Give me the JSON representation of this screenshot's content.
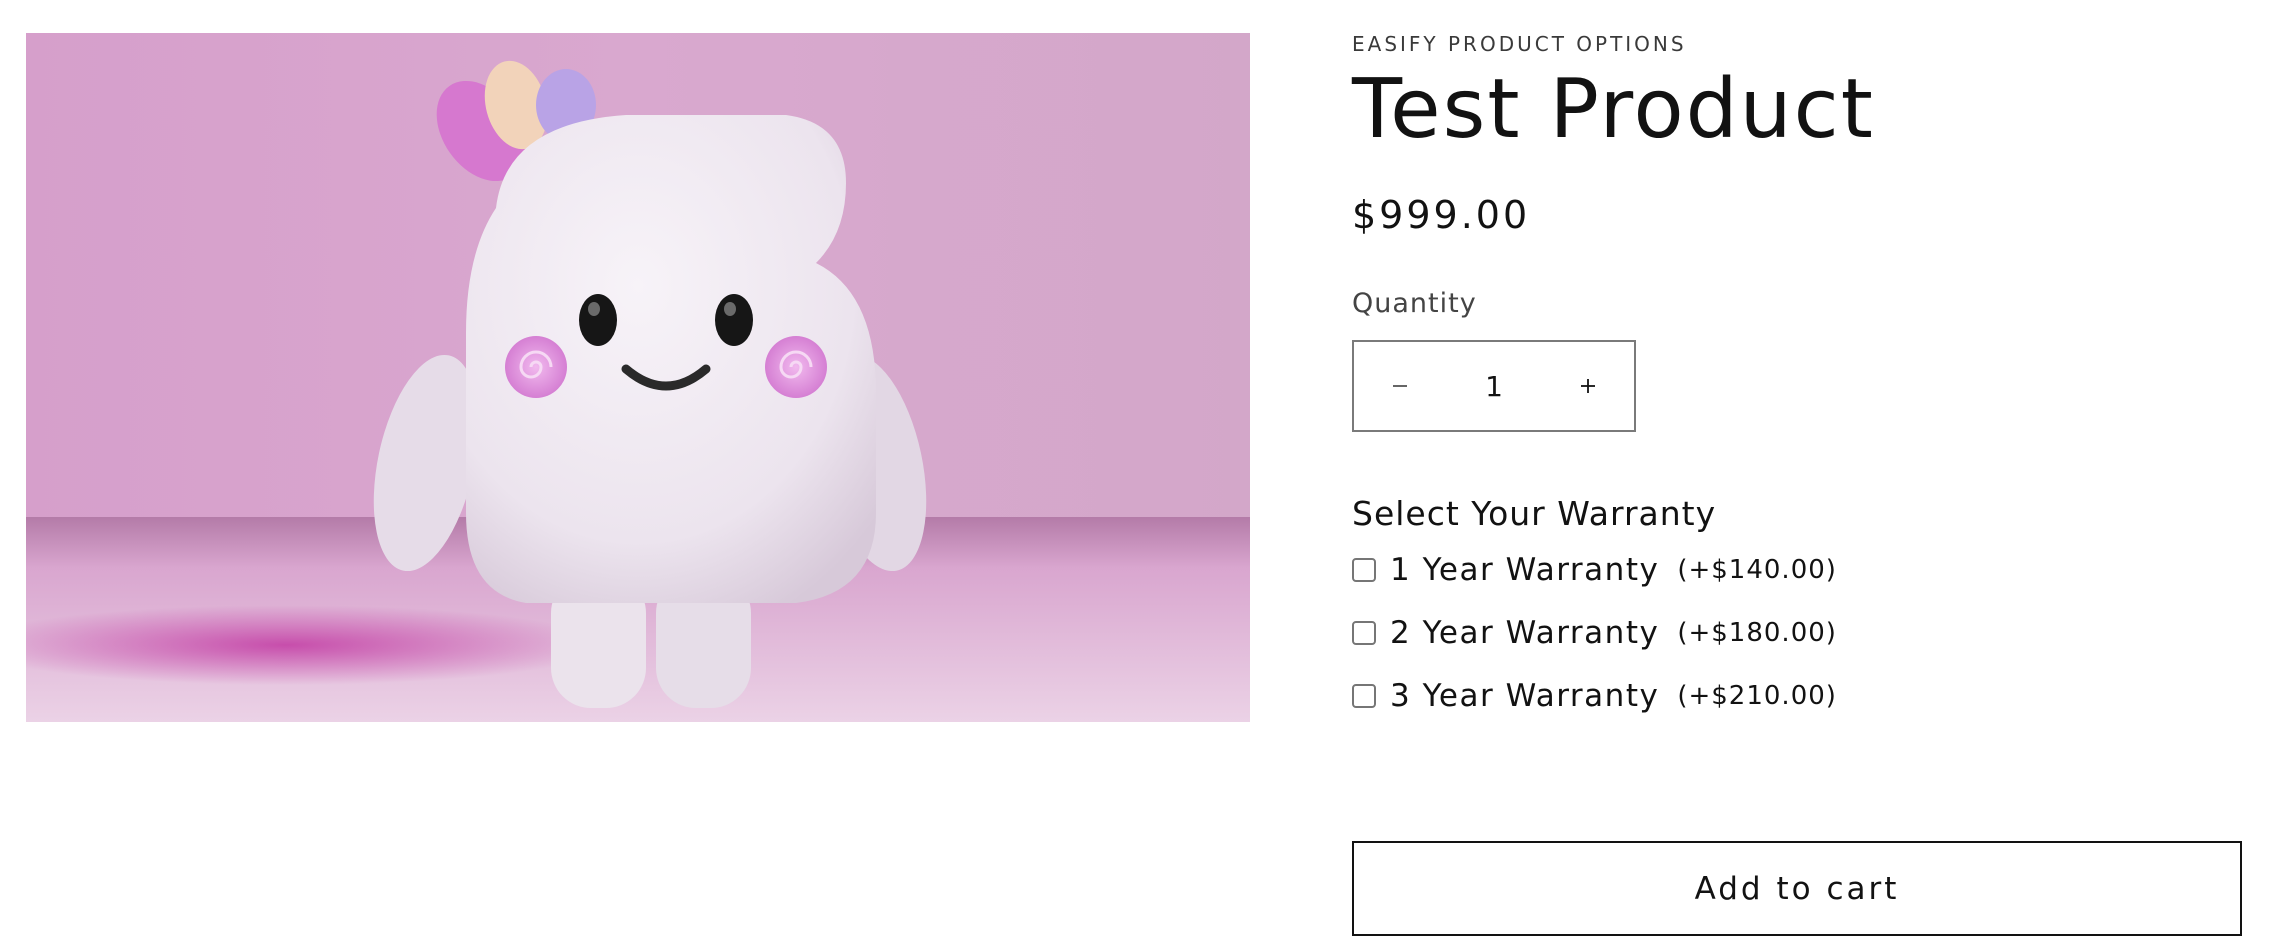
{
  "product": {
    "vendor": "EASIFY PRODUCT OPTIONS",
    "title": "Test Product",
    "price": "$999.00",
    "image_icon": "marshmallow-character-image"
  },
  "quantity": {
    "label": "Quantity",
    "value": "1",
    "decrease_icon": "minus-icon",
    "increase_icon": "plus-icon"
  },
  "warranty": {
    "title": "Select Your Warranty",
    "options": [
      {
        "label": "1 Year Warranty",
        "price": "(+$140.00)",
        "checked": false
      },
      {
        "label": "2 Year Warranty",
        "price": "(+$180.00)",
        "checked": false
      },
      {
        "label": "3 Year Warranty",
        "price": "(+$210.00)",
        "checked": false
      }
    ]
  },
  "cart": {
    "add_label": "Add to cart"
  },
  "colors": {
    "text": "#121212",
    "background_pink": "#d4a9c9",
    "accent_magenta": "#d85bb4"
  }
}
